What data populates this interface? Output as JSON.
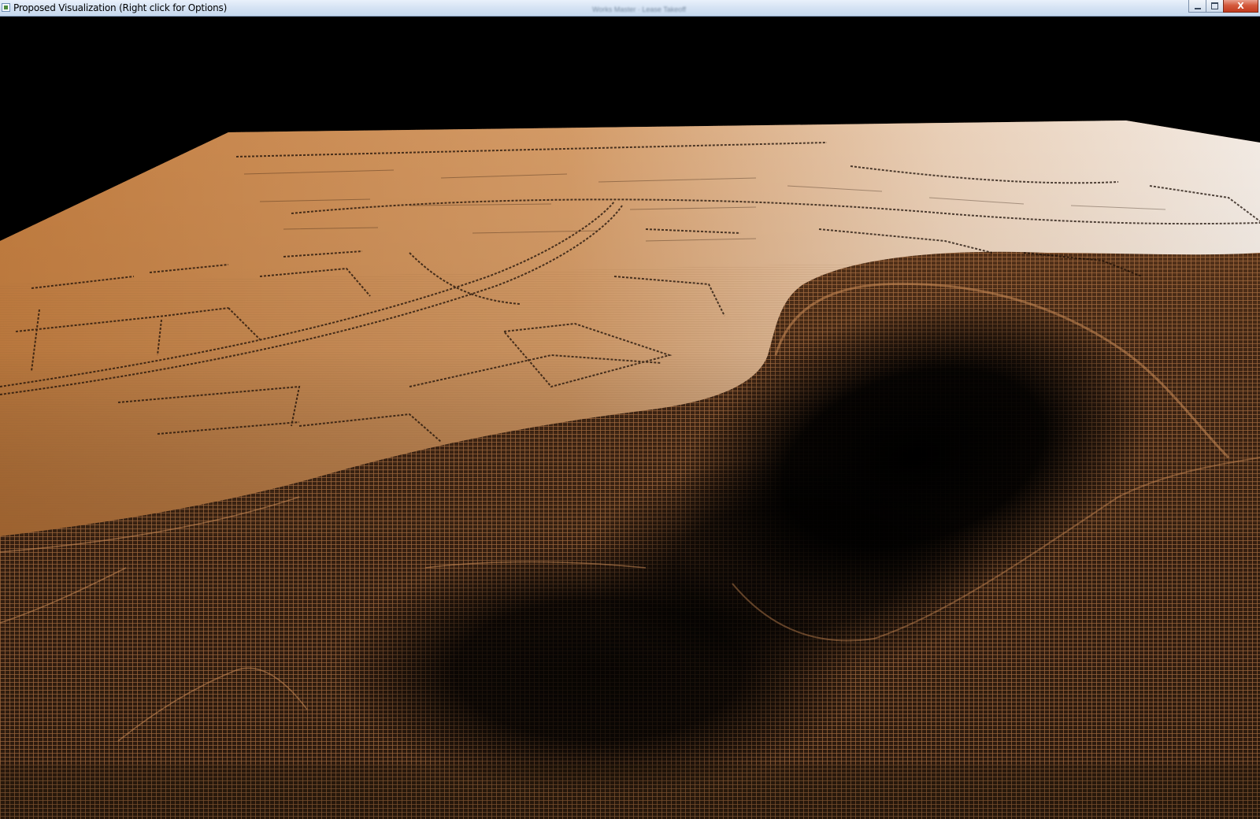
{
  "window": {
    "title": "Proposed Visualization (Right click for Options)",
    "background_title": "Works Master · Lease Takeoff",
    "controls": {
      "minimize": "",
      "maximize": "",
      "close": "X"
    }
  },
  "viewport": {
    "content": "3D wireframe terrain mesh",
    "mesh_color": "#c98a55",
    "surface_light": "#efe5dc",
    "surface_mid": "#c57f42",
    "background": "#000000"
  }
}
